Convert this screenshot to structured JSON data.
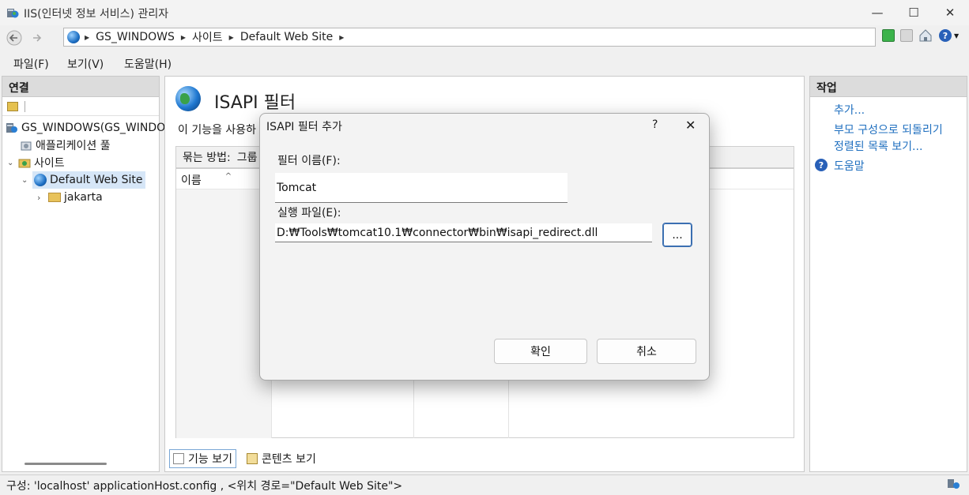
{
  "window": {
    "title": "IIS(인터넷 정보 서비스) 관리자",
    "minimize": "—",
    "maximize": "☐",
    "close": "✕"
  },
  "address": {
    "crumbs": [
      "GS_WINDOWS",
      "사이트",
      "Default Web Site"
    ]
  },
  "menu": {
    "items": [
      "파일(F)",
      "보기(V)",
      "도움말(H)"
    ]
  },
  "connections": {
    "header": "연결",
    "tree": [
      {
        "label": "GS_WINDOWS(GS_WINDO",
        "icon": "server-icon"
      },
      {
        "label": "애플리케이션 풀",
        "icon": "app-pool-icon"
      },
      {
        "label": "사이트",
        "icon": "sites-folder-icon"
      },
      {
        "label": "Default Web Site",
        "icon": "globe-icon"
      },
      {
        "label": "jakarta",
        "icon": "folder-icon"
      }
    ]
  },
  "center": {
    "title": "ISAPI 필터",
    "description": "이 기능을 사용하",
    "group_by_label": "묶는 방법:",
    "group_by_value": "그룹",
    "column_name": "이름",
    "tabs": [
      "기능 보기",
      "콘텐츠 보기"
    ]
  },
  "actions": {
    "header": "작업",
    "items": [
      "추가...",
      "부모 구성으로 되돌리기",
      "정렬된 목록 보기...",
      "도움말"
    ]
  },
  "status": {
    "text": "구성: 'localhost' applicationHost.config , <위치 경로=\"Default Web Site\">"
  },
  "dialog": {
    "title": "ISAPI 필터 추가",
    "help": "?",
    "close": "✕",
    "name_label": "필터 이름(F):",
    "name_value": "Tomcat",
    "exe_label": "실행 파일(E):",
    "exe_value": "D:₩Tools₩tomcat10.1₩connector₩bin₩isapi_redirect.dll",
    "browse_label": "...",
    "ok_label": "확인",
    "cancel_label": "취소"
  }
}
